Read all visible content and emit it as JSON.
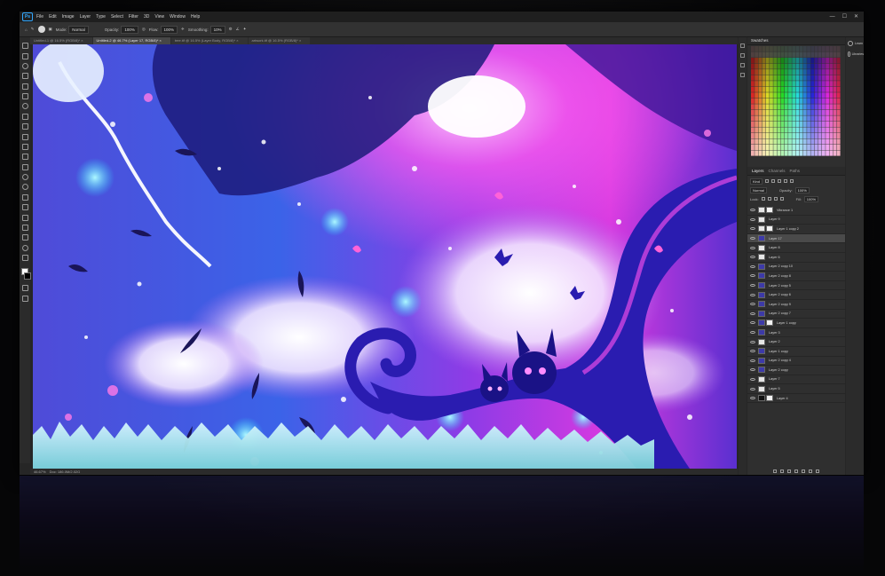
{
  "app": {
    "logo_text": "Ps"
  },
  "menu": [
    "File",
    "Edit",
    "Image",
    "Layer",
    "Type",
    "Select",
    "Filter",
    "3D",
    "View",
    "Window",
    "Help"
  ],
  "window_controls": [
    "—",
    "☐",
    "✕"
  ],
  "options": {
    "mode_label": "Mode:",
    "mode_value": "Normal",
    "opacity_label": "Opacity:",
    "opacity_value": "100%",
    "flow_label": "Flow:",
    "flow_value": "100%",
    "smoothing_label": "Smoothing:",
    "smoothing_value": "10%"
  },
  "doc_tabs": [
    "Untitled-1 @ 16.5% (RGB/8)* ×",
    "Untitled-2 @ 46.7% (Layer 17, RGB/8)* ×",
    "tree.tif @ 16.5% (Layer Body, RGB/8)* ×",
    "artwork.tif @ 16.5% (RGB/8)* ×"
  ],
  "status": {
    "zoom": "46.67%",
    "doc": "Doc: 186.0M/2.02G"
  },
  "panels": {
    "swatches_title": "Swatches",
    "tabs": [
      "Layers",
      "Channels",
      "Paths"
    ],
    "kind_label": "Kind",
    "blend_value": "Normal",
    "opacity_label": "Opacity:",
    "opacity_value": "100%",
    "lock_label": "Lock:",
    "fill_label": "Fill:",
    "fill_value": "100%",
    "learn_label": "Learn",
    "libraries_label": "Libraries"
  },
  "layers": [
    {
      "name": "Vibrance 1",
      "thumb": "w",
      "mask": true
    },
    {
      "name": "Layer 9",
      "thumb": "w",
      "mask": false
    },
    {
      "name": "Layer 1 copy 2",
      "thumb": "w",
      "mask": true
    },
    {
      "name": "Layer 17",
      "thumb": "b",
      "mask": false,
      "selected": true
    },
    {
      "name": "Layer 8",
      "thumb": "w",
      "mask": false
    },
    {
      "name": "Layer 6",
      "thumb": "w",
      "mask": false
    },
    {
      "name": "Layer 2 copy 10",
      "thumb": "b",
      "mask": false
    },
    {
      "name": "Layer 2 copy 8",
      "thumb": "b",
      "mask": false
    },
    {
      "name": "Layer 2 copy 5",
      "thumb": "b",
      "mask": false
    },
    {
      "name": "Layer 2 copy 6",
      "thumb": "b",
      "mask": false
    },
    {
      "name": "Layer 2 copy 9",
      "thumb": "b",
      "mask": false
    },
    {
      "name": "Layer 2 copy 7",
      "thumb": "b",
      "mask": false
    },
    {
      "name": "Layer 1 copy",
      "thumb": "b",
      "mask": true
    },
    {
      "name": "Layer 3",
      "thumb": "b",
      "mask": false
    },
    {
      "name": "Layer 2",
      "thumb": "w",
      "mask": false
    },
    {
      "name": "Layer 1 copy",
      "thumb": "b",
      "mask": false
    },
    {
      "name": "Layer 2 copy 4",
      "thumb": "b",
      "mask": false
    },
    {
      "name": "Layer 2 copy",
      "thumb": "b",
      "mask": false
    },
    {
      "name": "Layer 7",
      "thumb": "w",
      "mask": false
    },
    {
      "name": "Layer 5",
      "thumb": "w",
      "mask": false
    },
    {
      "name": "Layer 4",
      "thumb": "k",
      "mask": true
    }
  ],
  "colors": {
    "accent": "#31a8ff",
    "ui_dark": "#262626",
    "art_blue": "#2b3fd6",
    "art_magenta": "#e23be6",
    "art_sky": "#3aa0ff"
  }
}
